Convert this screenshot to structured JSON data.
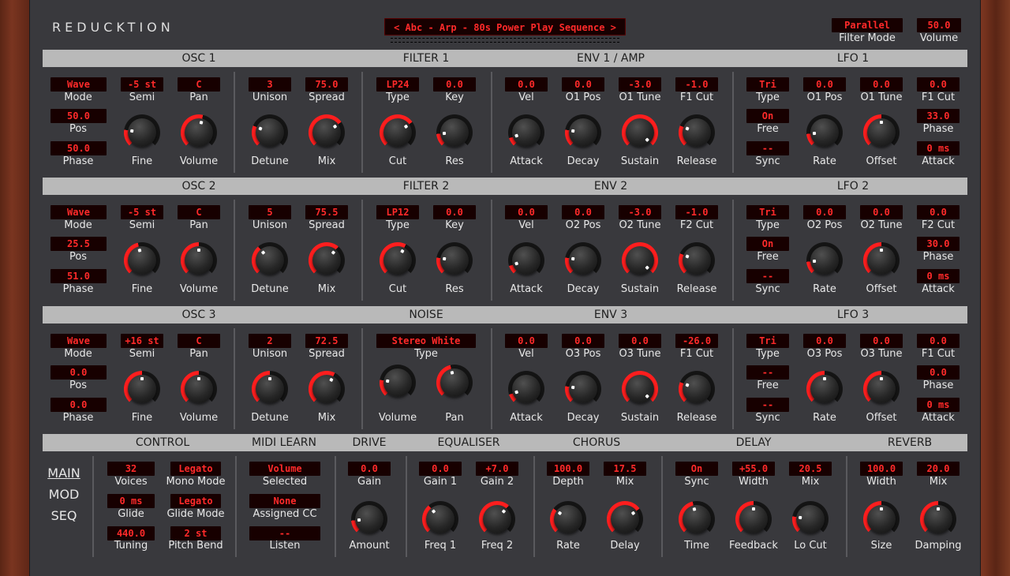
{
  "app": {
    "title": "REDUCKTION",
    "preset": "< Abc - Arp - 80s Power Play Sequence >"
  },
  "header": {
    "filter_mode": {
      "value": "Parallel",
      "label": "Filter Mode"
    },
    "volume": {
      "value": "50.0",
      "label": "Volume"
    }
  },
  "colors": {
    "lcd_text": "#ff2a2a",
    "knob_arc": "#ff1e1e",
    "panel": "#39393d",
    "band": "#b9b9b9"
  },
  "sections": {
    "r1": [
      "OSC 1",
      "FILTER 1",
      "ENV 1 / AMP",
      "LFO 1"
    ],
    "r2": [
      "OSC 2",
      "FILTER 2",
      "ENV 2",
      "LFO 2"
    ],
    "r3": [
      "OSC 3",
      "NOISE",
      "ENV 3",
      "LFO 3"
    ],
    "r4": [
      "CONTROL",
      "MIDI LEARN",
      "DRIVE",
      "EQUALISER",
      "CHORUS",
      "DELAY",
      "REVERB"
    ]
  },
  "osc": [
    {
      "mode": "Wave",
      "pos": "50.0",
      "phase": "50.0",
      "semi": "-5 st",
      "pan": "C",
      "unison": "3",
      "spread": "75.0"
    },
    {
      "mode": "Wave",
      "pos": "25.5",
      "phase": "51.0",
      "semi": "-5 st",
      "pan": "C",
      "unison": "5",
      "spread": "75.5"
    },
    {
      "mode": "Wave",
      "pos": "0.0",
      "phase": "0.0",
      "semi": "+16 st",
      "pan": "C",
      "unison": "2",
      "spread": "72.5"
    }
  ],
  "filter": [
    {
      "type": "LP24",
      "key": "0.0"
    },
    {
      "type": "LP12",
      "key": "0.0"
    }
  ],
  "noise": {
    "type": "Stereo White"
  },
  "env": [
    {
      "vel": "0.0",
      "pos": "0.0",
      "tune": "-3.0",
      "cut": "-1.0",
      "pos_label": "O1 Pos",
      "tune_label": "O1 Tune",
      "cut_label": "F1 Cut"
    },
    {
      "vel": "0.0",
      "pos": "0.0",
      "tune": "-3.0",
      "cut": "-1.0",
      "pos_label": "O2 Pos",
      "tune_label": "O2 Tune",
      "cut_label": "F2 Cut"
    },
    {
      "vel": "0.0",
      "pos": "0.0",
      "tune": "0.0",
      "cut": "-26.0",
      "pos_label": "O3 Pos",
      "tune_label": "O3 Tune",
      "cut_label": "F1 Cut"
    }
  ],
  "lfo": [
    {
      "type": "Tri",
      "free": "On",
      "sync": "--",
      "pos": "0.0",
      "tune": "0.0",
      "cut": "0.0",
      "phase": "33.0",
      "attack": "0 ms",
      "pos_label": "O1 Pos",
      "tune_label": "O1 Tune",
      "cut_label": "F1 Cut"
    },
    {
      "type": "Tri",
      "free": "On",
      "sync": "--",
      "pos": "0.0",
      "tune": "0.0",
      "cut": "0.0",
      "phase": "30.0",
      "attack": "0 ms",
      "pos_label": "O2 Pos",
      "tune_label": "O2 Tune",
      "cut_label": "F2 Cut"
    },
    {
      "type": "Tri",
      "free": "--",
      "sync": "--",
      "pos": "0.0",
      "tune": "0.0",
      "cut": "0.0",
      "phase": "0.0",
      "attack": "0 ms",
      "pos_label": "O3 Pos",
      "tune_label": "O3 Tune",
      "cut_label": "F1 Cut"
    }
  ],
  "labels": {
    "mode": "Mode",
    "pos": "Pos",
    "phase": "Phase",
    "semi": "Semi",
    "pan": "Pan",
    "fine": "Fine",
    "volume": "Volume",
    "unison": "Unison",
    "spread": "Spread",
    "detune": "Detune",
    "mix": "Mix",
    "type": "Type",
    "key": "Key",
    "cut": "Cut",
    "res": "Res",
    "vel": "Vel",
    "attack": "Attack",
    "decay": "Decay",
    "sustain": "Sustain",
    "release": "Release",
    "free": "Free",
    "sync": "Sync",
    "rate": "Rate",
    "offset": "Offset"
  },
  "nav": {
    "main": "MAIN",
    "mod": "MOD",
    "seq": "SEQ"
  },
  "control": {
    "voices": "32",
    "voices_l": "Voices",
    "mono": "Legato",
    "mono_l": "Mono Mode",
    "glide": "0 ms",
    "glide_l": "Glide",
    "glide_mode": "Legato",
    "glide_mode_l": "Glide Mode",
    "tuning": "440.0",
    "tuning_l": "Tuning",
    "pb": "2 st",
    "pb_l": "Pitch Bend"
  },
  "midi": {
    "selected": "Volume",
    "selected_l": "Selected",
    "cc": "None",
    "cc_l": "Assigned CC",
    "listen": "--",
    "listen_l": "Listen"
  },
  "drive": {
    "gain": "0.0",
    "gain_l": "Gain",
    "amount_l": "Amount"
  },
  "eq": {
    "gain1": "0.0",
    "gain1_l": "Gain 1",
    "gain2": "+7.0",
    "gain2_l": "Gain 2",
    "freq1_l": "Freq 1",
    "freq2_l": "Freq 2"
  },
  "chorus": {
    "depth": "100.0",
    "depth_l": "Depth",
    "mix": "17.5",
    "mix_l": "Mix",
    "rate_l": "Rate",
    "delay_l": "Delay"
  },
  "delay": {
    "sync": "On",
    "sync_l": "Sync",
    "width": "+55.0",
    "width_l": "Width",
    "mix": "20.5",
    "mix_l": "Mix",
    "time_l": "Time",
    "feedback_l": "Feedback",
    "locut_l": "Lo Cut"
  },
  "reverb": {
    "width": "100.0",
    "width_l": "Width",
    "mix": "20.0",
    "mix_l": "Mix",
    "size_l": "Size",
    "damping_l": "Damping"
  },
  "knobs": {
    "osc": [
      [
        0.2,
        0.55,
        0.25,
        0.7
      ],
      [
        0.45,
        0.5,
        0.35,
        0.65
      ],
      [
        0.5,
        0.5,
        0.5,
        0.6
      ]
    ],
    "filter": [
      [
        0.7,
        0.15
      ],
      [
        0.6,
        0.2
      ]
    ],
    "noise": [
      0.2,
      0.45
    ],
    "env": [
      [
        0.1,
        0.2,
        1.0,
        0.25
      ],
      [
        0.1,
        0.2,
        1.0,
        0.25
      ],
      [
        0.1,
        0.2,
        1.0,
        0.25
      ]
    ],
    "lfo": [
      [
        0.15,
        0.5
      ],
      [
        0.15,
        0.5
      ],
      [
        0.5,
        0.5
      ]
    ],
    "fx": {
      "drive": 0.15,
      "eq1": 0.35,
      "eq2": 0.65,
      "ch_rate": 0.3,
      "ch_delay": 0.7,
      "time": 0.45,
      "feedback": 0.5,
      "locut": 0.2,
      "size": 0.5,
      "damping": 0.5
    }
  }
}
